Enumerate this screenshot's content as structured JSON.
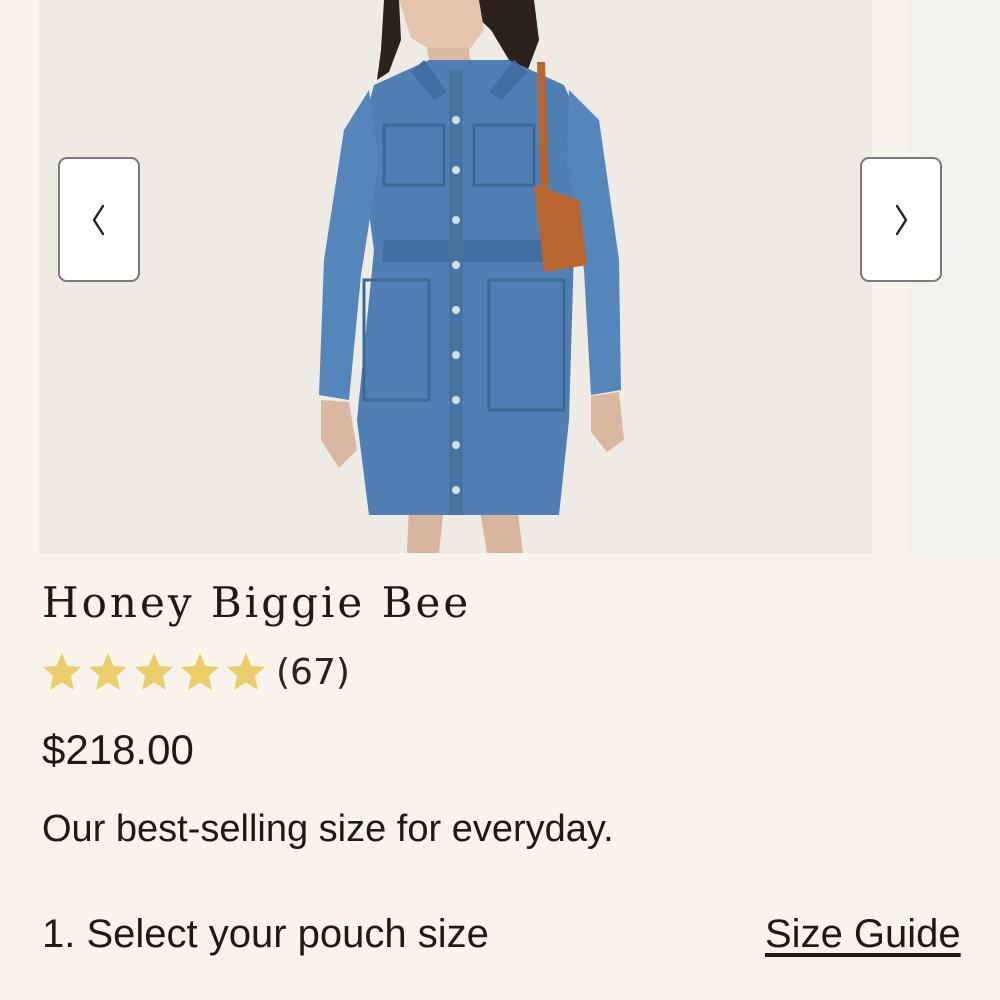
{
  "product": {
    "title": "Honey Biggie Bee",
    "rating": {
      "stars": 5,
      "max_stars": 5,
      "count_label": "(67)"
    },
    "price": "$218.00",
    "description": "Our best-selling size for everyday."
  },
  "selection": {
    "step_label": "1. Select your pouch size",
    "size_guide_label": "Size Guide"
  },
  "carousel": {
    "prev_icon": "chevron-left-icon",
    "next_icon": "chevron-right-icon"
  },
  "colors": {
    "background": "#f8f4ec",
    "star": "#ebcd6a",
    "denim": "#4f7fb3",
    "bag": "#b9652f"
  }
}
